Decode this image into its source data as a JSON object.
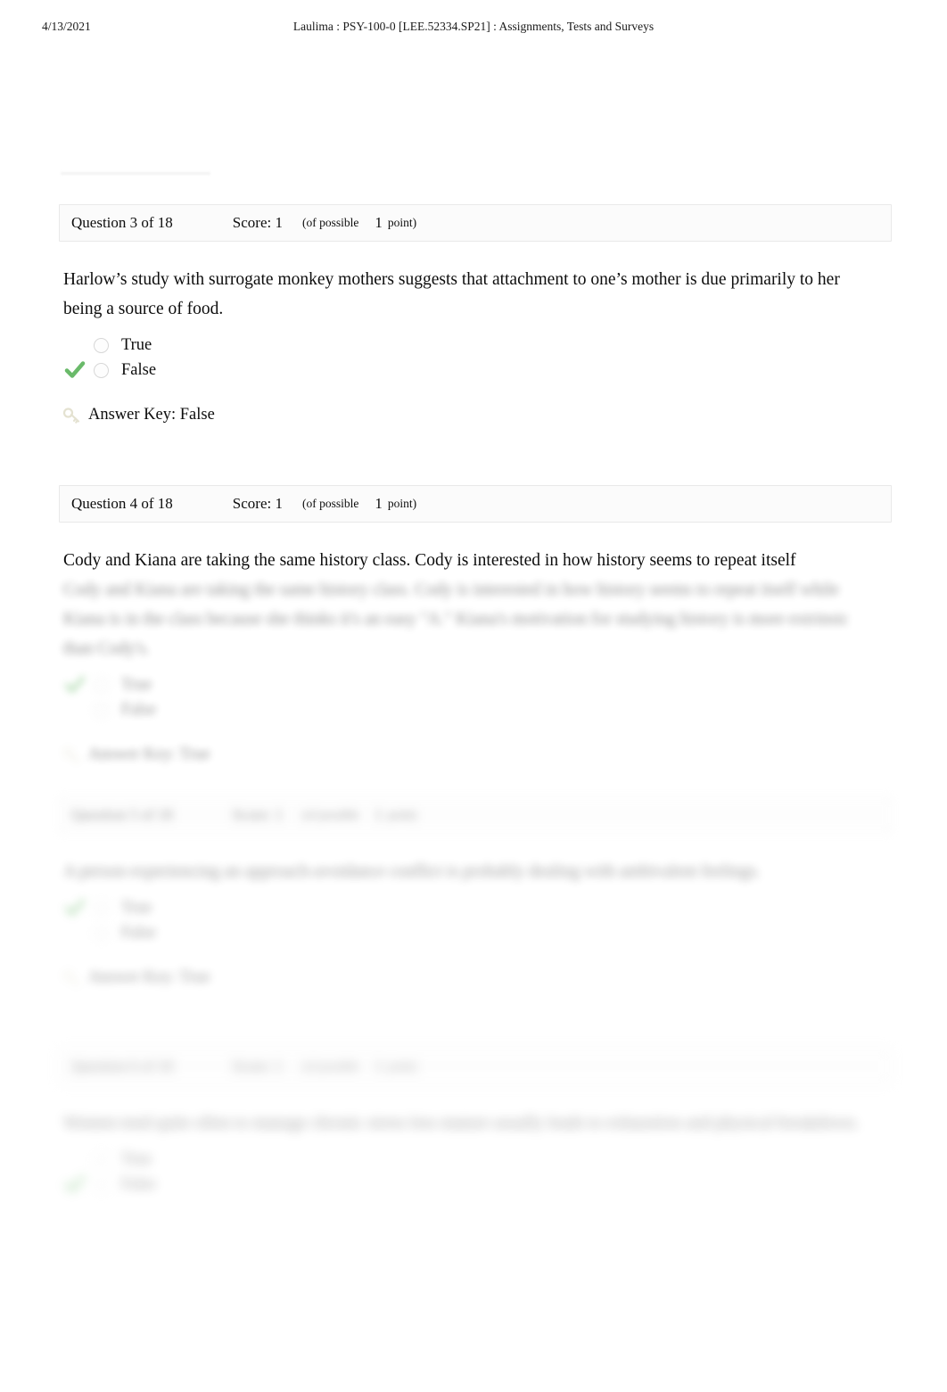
{
  "print_header": {
    "date": "4/13/2021",
    "document_title": "Laulima : PSY-100-0 [LEE.52334.SP21] : Assignments, Tests and Surveys"
  },
  "labels": {
    "score_prefix": "Score:",
    "possible_prefix": "(of possible",
    "point_unit": "point)",
    "answer_key_prefix": "Answer Key:",
    "correct_icon": "green-check-icon",
    "key_icon": "key-icon",
    "radio_icon": "radio-button-icon"
  },
  "colors": {
    "correct_green": "#6aba6a",
    "header_fill": "#fbfbfb",
    "header_border": "#e9e9e9",
    "text": "#0d0d0d"
  },
  "questions": [
    {
      "number_label": "Question 3 of 18",
      "score": "1",
      "possible": "1",
      "text": "Harlow’s study with surrogate monkey mothers suggests that attachment to one’s mother is due primarily to her being a source of food.",
      "options": [
        {
          "label": "True",
          "selected": false
        },
        {
          "label": "False",
          "selected": true
        }
      ],
      "answer_key": "Answer Key: False",
      "blur": "b0"
    },
    {
      "number_label": "Question 4 of 18",
      "score": "1",
      "possible": "1",
      "text": "Cody and Kiana are taking the same history class. Cody is interested in how history seems to repeat itself while Kiana is in the class because she thinks it's an easy \"A.\" Kiana's motivation for studying history is more extrinsic than Cody's.",
      "options": [
        {
          "label": "True",
          "selected": true
        },
        {
          "label": "False",
          "selected": false
        }
      ],
      "answer_key": "Answer Key: True",
      "blur": "b2"
    },
    {
      "number_label": "Question 5 of 18",
      "score": "1",
      "possible": "1",
      "text": "A person experiencing an approach-avoidance conflict is probably dealing with ambivalent feelings.",
      "options": [
        {
          "label": "True",
          "selected": true
        },
        {
          "label": "False",
          "selected": false
        }
      ],
      "answer_key": "Answer Key: True",
      "blur": "b4"
    },
    {
      "number_label": "Question 6 of 18",
      "score": "1",
      "possible": "1",
      "text": "Women tend quite often to manage chronic stress less mature usually leads to exhaustion and physical breakdown.",
      "options": [
        {
          "label": "True",
          "selected": false
        },
        {
          "label": "False",
          "selected": true
        }
      ],
      "answer_key": "",
      "blur": "b6"
    }
  ]
}
